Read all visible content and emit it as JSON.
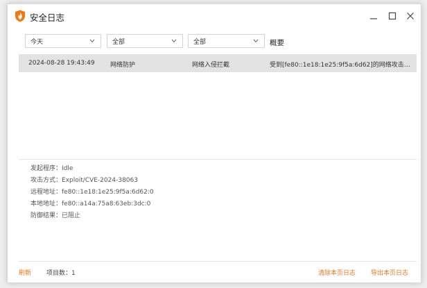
{
  "window": {
    "title": "安全日志"
  },
  "filters": {
    "time_range": "今天",
    "module": "全部",
    "event_type": "全部",
    "summary_header": "概要"
  },
  "log_rows": [
    {
      "time": "2024-08-28 19:43:49",
      "module": "网络防护",
      "type": "网络入侵拦截",
      "summary": "受到[fe80::1e18:1e25:9f5a:6d62]的网络攻击，..."
    }
  ],
  "details": {
    "initiator_label": "发起程序：",
    "initiator_value": "Idle",
    "attack_label": "攻击方式：",
    "attack_value": "Exploit/CVE-2024-38063",
    "remote_label": "远程地址：",
    "remote_value": "fe80::1e18:1e25:9f5a:6d62:0",
    "local_label": "本地地址：",
    "local_value": "fe80::a14a:75a8:63eb:3dc:0",
    "result_label": "防御结果：",
    "result_value": "已阻止"
  },
  "footer": {
    "refresh": "刷新",
    "count_label": "项目数：",
    "count_value": "1",
    "clear": "清除本页日志",
    "export": "导出本页日志"
  },
  "colors": {
    "accent": "#e8781c",
    "selected_row": "#e3e3e3"
  }
}
